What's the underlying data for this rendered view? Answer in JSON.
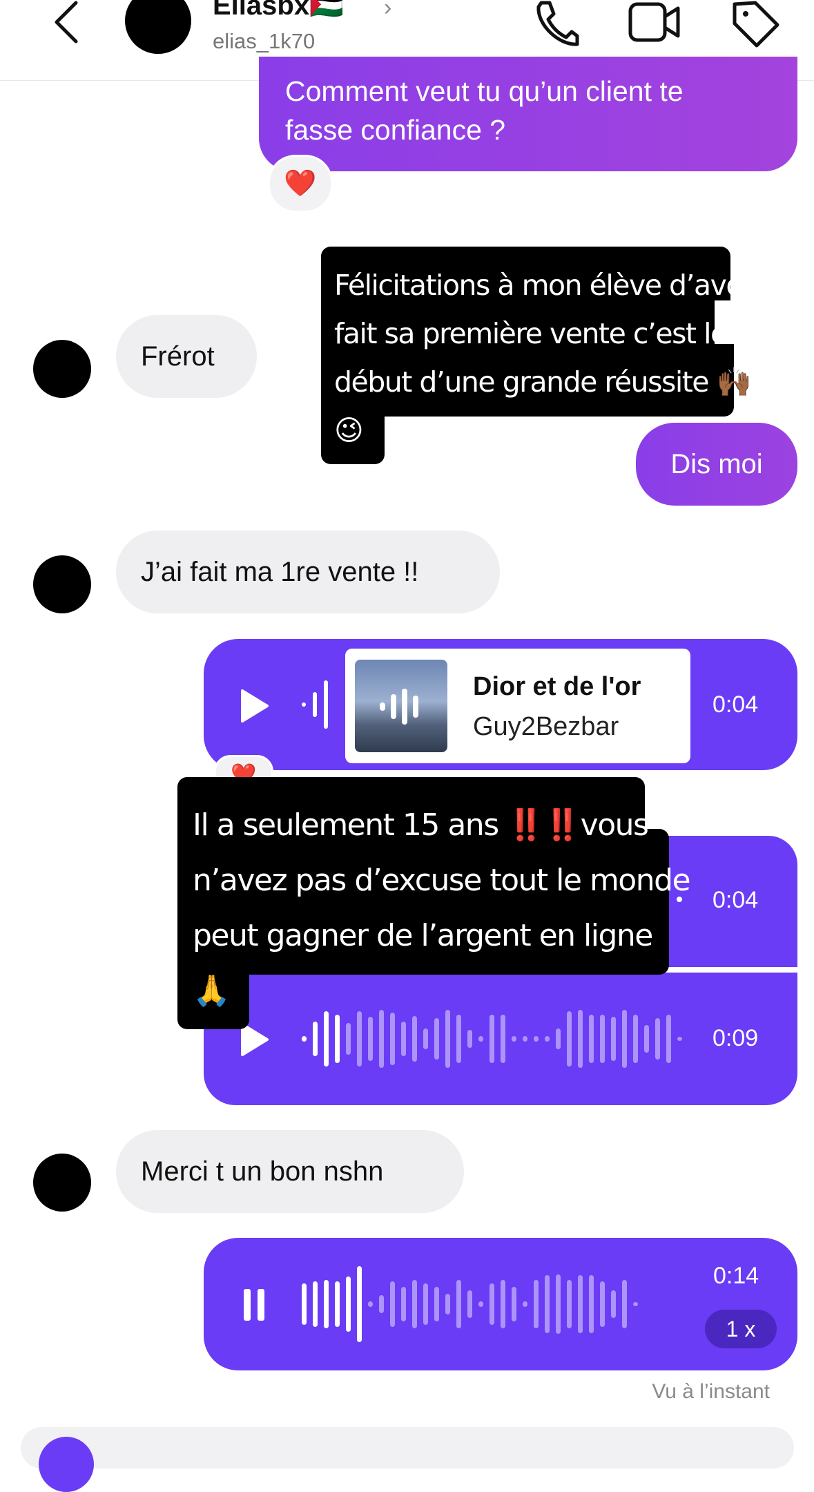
{
  "header": {
    "name": "Eliasbx",
    "flag": "🇵🇸",
    "username": "elias_1k70",
    "chevron": "›"
  },
  "messages": {
    "confidence_text": "Comment veut tu qu’un client te fasse confiance ?",
    "confidence_line1": "Comment veut tu qu’un client te",
    "confidence_line2": "fasse confiance ?",
    "reaction_emoji": "❤️",
    "frerot": "Frérot",
    "dis_moi": "Dis moi",
    "premiere_vente": "J’ai fait ma 1re vente !!",
    "merci": "Merci t un bon nshn"
  },
  "music_share": {
    "title": "Dior et de l'or",
    "artist": "Guy2Bezbar",
    "duration": "0:04"
  },
  "voice_notes": [
    {
      "duration": "0:04"
    },
    {
      "duration": "0:09"
    },
    {
      "duration": "0:14",
      "speed": "1 x"
    }
  ],
  "overlays": {
    "congrats_line1": "Félicitations à mon élève d’avoir",
    "congrats_line2": "fait sa première vente c’est le",
    "congrats_line3": "début d’une grande réussite 🙌🏾",
    "congrats_line4": "😉",
    "age_line1": "Il a seulement 15 ans ‼️‼️vous",
    "age_line2": "n’avez pas d’excuse tout le monde",
    "age_line3": "peut gagner de l’argent en ligne",
    "age_line4": "🙏"
  },
  "status": {
    "seen": "Vu à l’instant"
  },
  "colors": {
    "accent_purple": "#6a3cf5",
    "bubble_gradient_start": "#7a3cf0",
    "bubble_gradient_end": "#9b3fe0",
    "incoming_bubble": "#efeff1"
  },
  "icons": [
    "back-chevron-icon",
    "phone-icon",
    "video-call-icon",
    "tag-icon",
    "play-icon",
    "pause-icon",
    "waveform-icon",
    "heart-icon"
  ]
}
